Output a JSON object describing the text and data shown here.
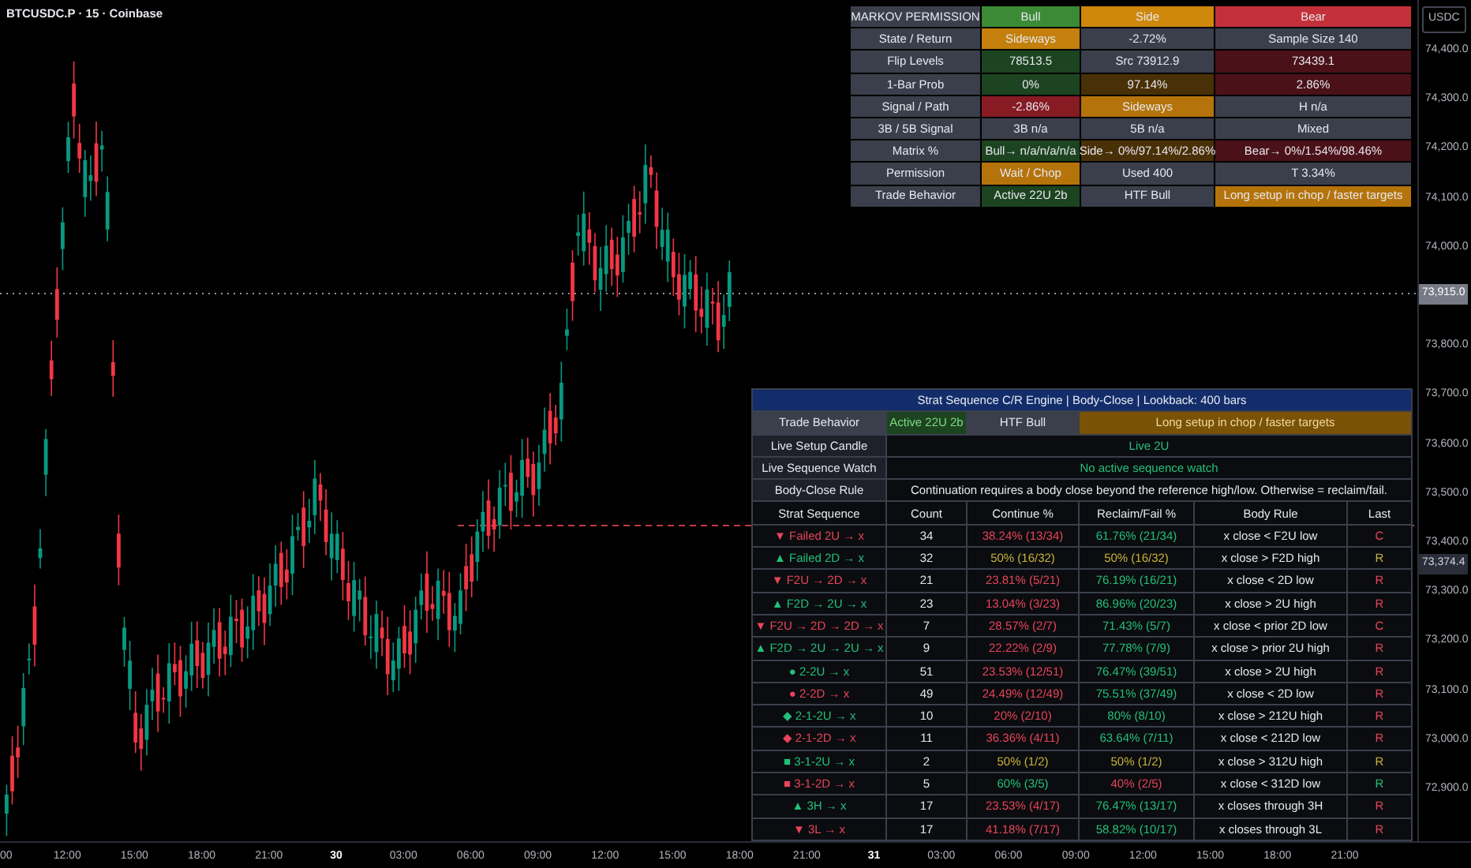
{
  "chart_header": {
    "title": "BTCUSDC.P · 15 · Coinbase"
  },
  "price_axis": {
    "currency": "USDC",
    "ticks": [
      "74,400.0",
      "74,300.0",
      "74,200.0",
      "74,100.0",
      "74,000.0",
      "73,800.0",
      "73,700.0",
      "73,600.0",
      "73,500.0",
      "73,400.0",
      "73,300.0",
      "73,200.0",
      "73,100.0",
      "73,000.0",
      "72,900.0"
    ],
    "last_price": "73,915.0",
    "marker_price": "73,374.4"
  },
  "time_axis": {
    "ticks": [
      {
        "label": "00",
        "bold": false
      },
      {
        "label": "12:00",
        "bold": false
      },
      {
        "label": "15:00",
        "bold": false
      },
      {
        "label": "18:00",
        "bold": false
      },
      {
        "label": "21:00",
        "bold": false
      },
      {
        "label": "30",
        "bold": true
      },
      {
        "label": "03:00",
        "bold": false
      },
      {
        "label": "06:00",
        "bold": false
      },
      {
        "label": "09:00",
        "bold": false
      },
      {
        "label": "12:00",
        "bold": false
      },
      {
        "label": "15:00",
        "bold": false
      },
      {
        "label": "18:00",
        "bold": false
      },
      {
        "label": "21:00",
        "bold": false
      },
      {
        "label": "31",
        "bold": true
      },
      {
        "label": "03:00",
        "bold": false
      },
      {
        "label": "06:00",
        "bold": false
      },
      {
        "label": "09:00",
        "bold": false
      },
      {
        "label": "12:00",
        "bold": false
      },
      {
        "label": "15:00",
        "bold": false
      },
      {
        "label": "18:00",
        "bold": false
      },
      {
        "label": "21:00",
        "bold": false
      }
    ]
  },
  "markov_table": {
    "header": [
      {
        "text": "MARKOV PERMISSION",
        "color": "#3a3f4b"
      },
      {
        "text": "Bull",
        "color": "#3b8a35"
      },
      {
        "text": "Side",
        "color": "#cf870c"
      },
      {
        "text": "Bear",
        "color": "#c4303a"
      }
    ],
    "rows": [
      {
        "label": "State / Return",
        "cells": [
          {
            "text": "Sideways",
            "color": "#c47f0c"
          },
          {
            "text": "-2.72%",
            "color": "#3a3f4b"
          },
          {
            "text": "Sample Size 140",
            "color": "#3a3f4b"
          }
        ]
      },
      {
        "label": "Flip Levels",
        "cells": [
          {
            "text": "78513.5",
            "color": "#1d4420"
          },
          {
            "text": "Src 73912.9",
            "color": "#3a3f4b"
          },
          {
            "text": "73439.1",
            "color": "#4b1118"
          }
        ]
      },
      {
        "label": "1-Bar Prob",
        "cells": [
          {
            "text": "0%",
            "color": "#1d4420"
          },
          {
            "text": "97.14%",
            "color": "#4a3007"
          },
          {
            "text": "2.86%",
            "color": "#4b1118"
          }
        ]
      },
      {
        "label": "Signal / Path",
        "cells": [
          {
            "text": "-2.86%",
            "color": "#871b24"
          },
          {
            "text": "Sideways",
            "color": "#b5730b"
          },
          {
            "text": "H n/a",
            "color": "#3a3f4b"
          }
        ]
      },
      {
        "label": "3B / 5B Signal",
        "cells": [
          {
            "text": "3B n/a",
            "color": "#3a3f4b"
          },
          {
            "text": "5B n/a",
            "color": "#3a3f4b"
          },
          {
            "text": "Mixed",
            "color": "#3a3f4b"
          }
        ]
      },
      {
        "label": "Matrix %",
        "cells": [
          {
            "text": "Bull→ n/a/n/a/n/a",
            "color": "#1d4420"
          },
          {
            "text": "Side→ 0%/97.14%/2.86%",
            "color": "#4a3007"
          },
          {
            "text": "Bear→ 0%/1.54%/98.46%",
            "color": "#4b1118"
          }
        ]
      },
      {
        "label": "Permission",
        "cells": [
          {
            "text": "Wait / Chop",
            "color": "#b5730b"
          },
          {
            "text": "Used 400",
            "color": "#3a3f4b"
          },
          {
            "text": "T 3.34%",
            "color": "#3a3f4b"
          }
        ]
      },
      {
        "label": "Trade Behavior",
        "cells": [
          {
            "text": "Active 22U 2b",
            "color": "#1d4420"
          },
          {
            "text": "HTF Bull",
            "color": "#3a3f4b"
          },
          {
            "text": "Long setup in chop / faster targets",
            "color": "#b5730b"
          }
        ]
      }
    ]
  },
  "strat_table": {
    "title": "Strat Sequence C/R Engine | Body-Close | Lookback: 400 bars",
    "trade_behavior": {
      "label": "Trade Behavior",
      "cells": [
        {
          "text": "Active 22U 2b",
          "kind": "bull"
        },
        {
          "text": "HTF Bull",
          "kind": "neutral"
        },
        {
          "text": "Long setup in chop / faster targets",
          "kind": "caution"
        }
      ]
    },
    "info_rows": [
      {
        "label": "Live Setup Candle",
        "value": "Live 2U",
        "kind": "up"
      },
      {
        "label": "Live Sequence Watch",
        "value": "No active sequence watch",
        "kind": "up"
      },
      {
        "label": "Body-Close Rule",
        "value": "Continuation requires a body close beyond the reference high/low. Otherwise = reclaim/fail.",
        "kind": "plain"
      }
    ],
    "columns": [
      "Strat Sequence",
      "Count",
      "Continue %",
      "Reclaim/Fail %",
      "Body Rule",
      "Last"
    ],
    "rows": [
      {
        "sequence": "▼ Failed 2U → x",
        "kind": "down",
        "count": "34",
        "continue": {
          "text": "38.24% (13/34)",
          "kind": "down"
        },
        "reclaim": {
          "text": "61.76% (21/34)",
          "kind": "up"
        },
        "rule": "x close < F2U low",
        "last": {
          "text": "C",
          "kind": "down"
        }
      },
      {
        "sequence": "▲ Failed 2D → x",
        "kind": "up",
        "count": "32",
        "continue": {
          "text": "50% (16/32)",
          "kind": "even"
        },
        "reclaim": {
          "text": "50% (16/32)",
          "kind": "even"
        },
        "rule": "x close > F2D high",
        "last": {
          "text": "R",
          "kind": "even"
        }
      },
      {
        "sequence": "▼ F2U → 2D → x",
        "kind": "down",
        "count": "21",
        "continue": {
          "text": "23.81% (5/21)",
          "kind": "down"
        },
        "reclaim": {
          "text": "76.19% (16/21)",
          "kind": "up"
        },
        "rule": "x close < 2D low",
        "last": {
          "text": "R",
          "kind": "down"
        }
      },
      {
        "sequence": "▲ F2D → 2U → x",
        "kind": "up",
        "count": "23",
        "continue": {
          "text": "13.04% (3/23)",
          "kind": "down"
        },
        "reclaim": {
          "text": "86.96% (20/23)",
          "kind": "up"
        },
        "rule": "x close > 2U high",
        "last": {
          "text": "R",
          "kind": "down"
        }
      },
      {
        "sequence": "▼ F2U → 2D → 2D → x",
        "kind": "down",
        "count": "7",
        "continue": {
          "text": "28.57% (2/7)",
          "kind": "down"
        },
        "reclaim": {
          "text": "71.43% (5/7)",
          "kind": "up"
        },
        "rule": "x close < prior 2D low",
        "last": {
          "text": "C",
          "kind": "down"
        }
      },
      {
        "sequence": "▲ F2D → 2U → 2U → x",
        "kind": "up",
        "count": "9",
        "continue": {
          "text": "22.22% (2/9)",
          "kind": "down"
        },
        "reclaim": {
          "text": "77.78% (7/9)",
          "kind": "up"
        },
        "rule": "x close > prior 2U high",
        "last": {
          "text": "R",
          "kind": "down"
        }
      },
      {
        "sequence": "● 2-2U → x",
        "kind": "up",
        "count": "51",
        "continue": {
          "text": "23.53% (12/51)",
          "kind": "down"
        },
        "reclaim": {
          "text": "76.47% (39/51)",
          "kind": "up"
        },
        "rule": "x close > 2U high",
        "last": {
          "text": "R",
          "kind": "down"
        }
      },
      {
        "sequence": "● 2-2D → x",
        "kind": "down",
        "count": "49",
        "continue": {
          "text": "24.49% (12/49)",
          "kind": "down"
        },
        "reclaim": {
          "text": "75.51% (37/49)",
          "kind": "up"
        },
        "rule": "x close < 2D low",
        "last": {
          "text": "R",
          "kind": "down"
        }
      },
      {
        "sequence": "◆ 2-1-2U → x",
        "kind": "up",
        "count": "10",
        "continue": {
          "text": "20% (2/10)",
          "kind": "down"
        },
        "reclaim": {
          "text": "80% (8/10)",
          "kind": "up"
        },
        "rule": "x close > 212U high",
        "last": {
          "text": "R",
          "kind": "down"
        }
      },
      {
        "sequence": "◆ 2-1-2D → x",
        "kind": "down",
        "count": "11",
        "continue": {
          "text": "36.36% (4/11)",
          "kind": "down"
        },
        "reclaim": {
          "text": "63.64% (7/11)",
          "kind": "up"
        },
        "rule": "x close < 212D low",
        "last": {
          "text": "R",
          "kind": "down"
        }
      },
      {
        "sequence": "■ 3-1-2U → x",
        "kind": "up",
        "count": "2",
        "continue": {
          "text": "50% (1/2)",
          "kind": "even"
        },
        "reclaim": {
          "text": "50% (1/2)",
          "kind": "even"
        },
        "rule": "x close > 312U high",
        "last": {
          "text": "R",
          "kind": "even"
        }
      },
      {
        "sequence": "■ 3-1-2D → x",
        "kind": "down",
        "count": "5",
        "continue": {
          "text": "60% (3/5)",
          "kind": "up"
        },
        "reclaim": {
          "text": "40% (2/5)",
          "kind": "down"
        },
        "rule": "x close < 312D low",
        "last": {
          "text": "R",
          "kind": "up"
        }
      },
      {
        "sequence": "▲ 3H → x",
        "kind": "up",
        "count": "17",
        "continue": {
          "text": "23.53% (4/17)",
          "kind": "down"
        },
        "reclaim": {
          "text": "76.47% (13/17)",
          "kind": "up"
        },
        "rule": "x closes through 3H",
        "last": {
          "text": "R",
          "kind": "down"
        }
      },
      {
        "sequence": "▼ 3L → x",
        "kind": "down",
        "count": "17",
        "continue": {
          "text": "41.18% (7/17)",
          "kind": "down"
        },
        "reclaim": {
          "text": "58.82% (10/17)",
          "kind": "up"
        },
        "rule": "x closes through 3L",
        "last": {
          "text": "R",
          "kind": "down"
        }
      }
    ]
  }
}
